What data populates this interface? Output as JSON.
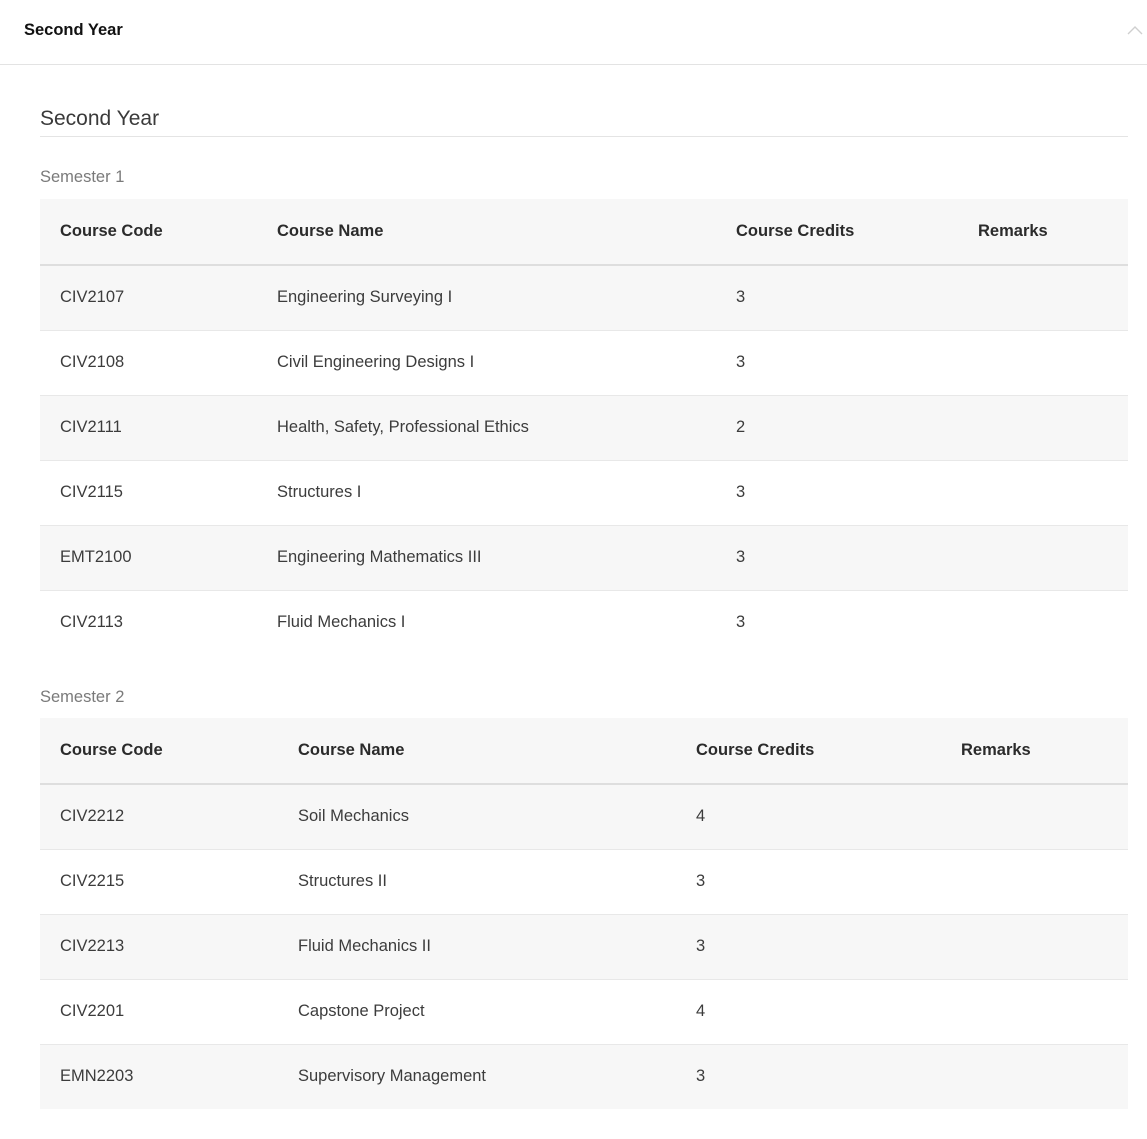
{
  "accordion": {
    "title": "Second Year",
    "icon": "chevron-up-icon"
  },
  "section": {
    "title": "Second Year"
  },
  "semesters": [
    {
      "label": "Semester 1",
      "headers": [
        "Course Code",
        "Course Name",
        "Course Credits",
        "Remarks"
      ],
      "rows": [
        {
          "code": "CIV2107",
          "name": "Engineering Surveying I",
          "credits": "3",
          "remarks": ""
        },
        {
          "code": "CIV2108",
          "name": "Civil Engineering Designs I",
          "credits": "3",
          "remarks": ""
        },
        {
          "code": "CIV2111",
          "name": "Health, Safety, Professional Ethics",
          "credits": "2",
          "remarks": ""
        },
        {
          "code": "CIV2115",
          "name": "Structures I",
          "credits": "3",
          "remarks": ""
        },
        {
          "code": "EMT2100",
          "name": "Engineering Mathematics III",
          "credits": "3",
          "remarks": ""
        },
        {
          "code": "CIV2113",
          "name": "Fluid Mechanics I",
          "credits": "3",
          "remarks": ""
        }
      ]
    },
    {
      "label": "Semester 2",
      "headers": [
        "Course Code",
        "Course Name",
        "Course Credits",
        "Remarks"
      ],
      "rows": [
        {
          "code": "CIV2212",
          "name": "Soil Mechanics",
          "credits": "4",
          "remarks": ""
        },
        {
          "code": "CIV2215",
          "name": "Structures II",
          "credits": "3",
          "remarks": ""
        },
        {
          "code": "CIV2213",
          "name": "Fluid Mechanics II",
          "credits": "3",
          "remarks": ""
        },
        {
          "code": "CIV2201",
          "name": "Capstone Project",
          "credits": "4",
          "remarks": ""
        },
        {
          "code": "EMN2203",
          "name": "Supervisory Management",
          "credits": "3",
          "remarks": ""
        }
      ]
    }
  ]
}
